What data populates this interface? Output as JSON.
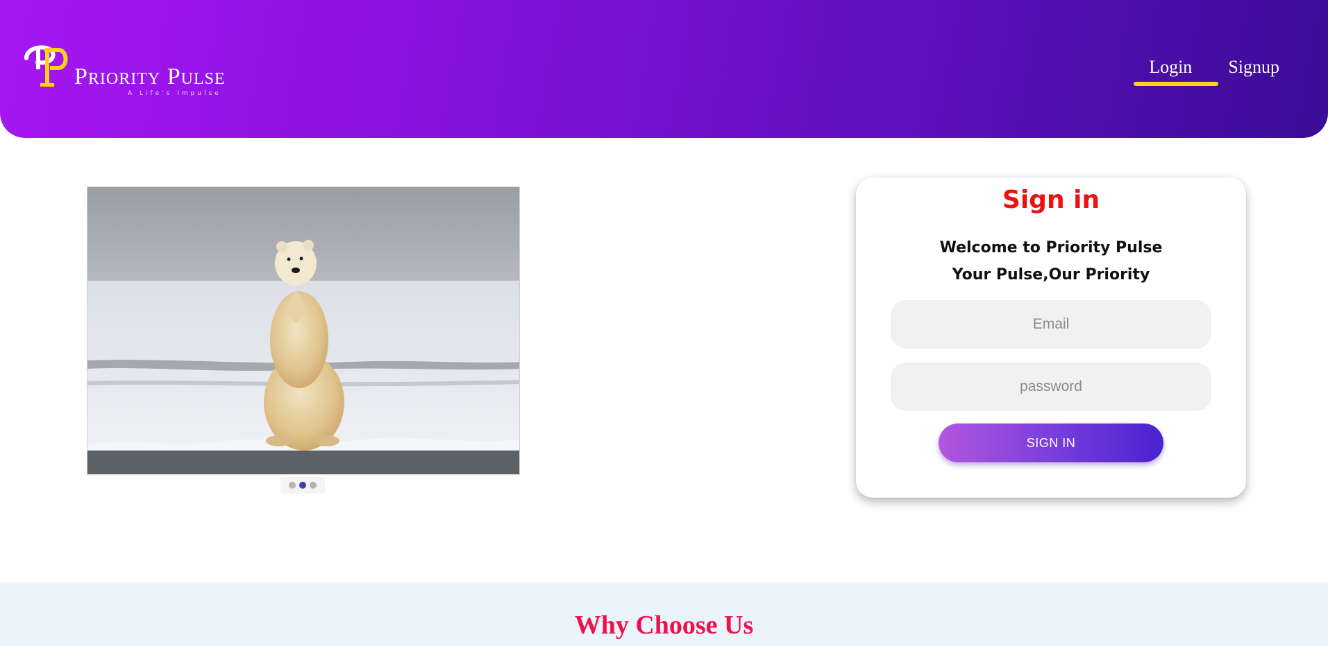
{
  "header": {
    "brand_name": "Priority Pulse",
    "brand_tagline": "A Life's Impulse",
    "logo_monogram": "PP",
    "nav": [
      {
        "label": "Login",
        "active": true
      },
      {
        "label": "Signup",
        "active": false
      }
    ],
    "accent_color": "#ffd21a"
  },
  "carousel": {
    "image_subject": "polar bear standing on snow",
    "slide_count": 3,
    "active_index": 1
  },
  "signin": {
    "title": "Sign in",
    "welcome_line1": "Welcome to Priority Pulse",
    "welcome_line2": "Your Pulse,Our Priority",
    "email_placeholder": "Email",
    "password_placeholder": "password",
    "button_label": "SIGN IN"
  },
  "why": {
    "title": "Why Choose Us"
  },
  "colors": {
    "header_start": "#a716f2",
    "header_end": "#3a0c96",
    "signin_title": "#ee1111",
    "why_title": "#f0104a"
  }
}
